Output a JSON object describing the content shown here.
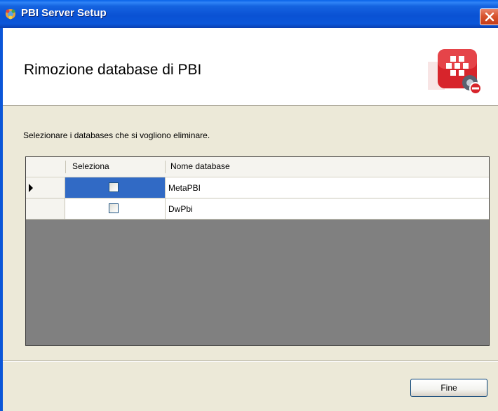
{
  "window": {
    "title": "PBI Server Setup"
  },
  "header": {
    "title": "Rimozione database di PBI",
    "logo_icon": "setup-remove-logo-icon"
  },
  "instruction": "Selezionare i databases che si vogliono eliminare.",
  "grid": {
    "columns": [
      "Seleziona",
      "Nome database"
    ],
    "rows": [
      {
        "selected": false,
        "name": "MetaPBI",
        "current": true
      },
      {
        "selected": false,
        "name": "DwPbi",
        "current": false
      }
    ]
  },
  "footer": {
    "fine_label": "Fine"
  },
  "colors": {
    "titlebar": "#0a52d4",
    "selection": "#316ac5",
    "grid_background": "#808080",
    "close_button": "#c33b17"
  }
}
